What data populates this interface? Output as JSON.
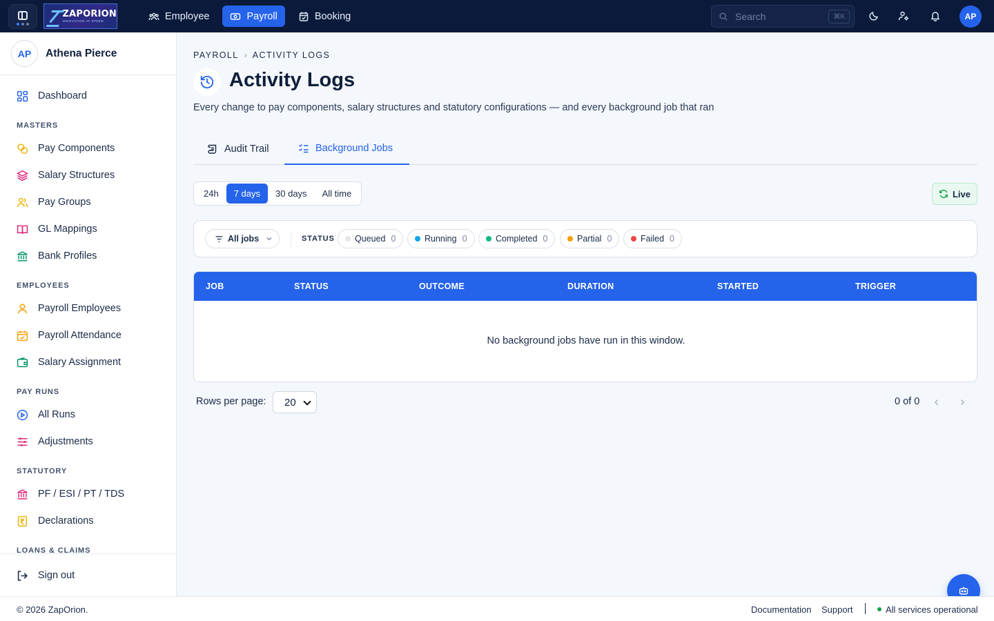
{
  "topbar": {
    "logo_text": "ZAPORION",
    "logo_tagline": "INNOVATION AT SPEED",
    "nav": [
      {
        "label": "Employee",
        "icon": "users-icon",
        "active": false
      },
      {
        "label": "Payroll",
        "icon": "money-icon",
        "active": true
      },
      {
        "label": "Booking",
        "icon": "calendar-check-icon",
        "active": false
      }
    ],
    "search_placeholder": "Search",
    "search_shortcut": "⌘K",
    "avatar_initials": "AP"
  },
  "sidebar": {
    "user_initials": "AP",
    "user_name": "Athena Pierce",
    "dashboard": "Dashboard",
    "sections": {
      "masters": "MASTERS",
      "employees": "EMPLOYEES",
      "pay_runs": "PAY RUNS",
      "statutory": "STATUTORY",
      "loans": "LOANS & CLAIMS"
    },
    "items": {
      "pay_components": "Pay Components",
      "salary_structures": "Salary Structures",
      "pay_groups": "Pay Groups",
      "gl_mappings": "GL Mappings",
      "bank_profiles": "Bank Profiles",
      "payroll_employees": "Payroll Employees",
      "payroll_attendance": "Payroll Attendance",
      "salary_assignment": "Salary Assignment",
      "all_runs": "All Runs",
      "adjustments": "Adjustments",
      "pf_esi": "PF / ESI / PT / TDS",
      "declarations": "Declarations"
    },
    "sign_out": "Sign out"
  },
  "main": {
    "breadcrumb": [
      "PAYROLL",
      "ACTIVITY LOGS"
    ],
    "title": "Activity Logs",
    "subtitle": "Every change to pay components, salary structures and statutory configurations — and every background job that ran",
    "tabs": [
      {
        "label": "Audit Trail",
        "active": false
      },
      {
        "label": "Background Jobs",
        "active": true
      }
    ],
    "ranges": [
      {
        "label": "24h",
        "active": false
      },
      {
        "label": "7 days",
        "active": true
      },
      {
        "label": "30 days",
        "active": false
      },
      {
        "label": "All time",
        "active": false
      }
    ],
    "live_label": "Live",
    "filter": {
      "all_jobs": "All jobs",
      "status_label": "STATUS",
      "chips": [
        {
          "label": "Queued",
          "count": "0",
          "color": "#e5e7eb"
        },
        {
          "label": "Running",
          "count": "0",
          "color": "#0ea5e9"
        },
        {
          "label": "Completed",
          "count": "0",
          "color": "#10b981"
        },
        {
          "label": "Partial",
          "count": "0",
          "color": "#f59e0b"
        },
        {
          "label": "Failed",
          "count": "0",
          "color": "#ef4444"
        }
      ]
    },
    "table": {
      "columns": [
        "JOB",
        "STATUS",
        "OUTCOME",
        "DURATION",
        "STARTED",
        "TRIGGER"
      ],
      "empty_message": "No background jobs have run in this window."
    },
    "pagination": {
      "rows_per_page_label": "Rows per page:",
      "rows_per_page": "20",
      "range_text": "0 of 0"
    }
  },
  "footer": {
    "copyright": "© 2026 ZapOrion.",
    "documentation": "Documentation",
    "support": "Support",
    "status": "All services operational"
  },
  "colors": {
    "accent": "#2563eb",
    "topbar": "#0b1a3a",
    "status_ok": "#16a34a"
  }
}
